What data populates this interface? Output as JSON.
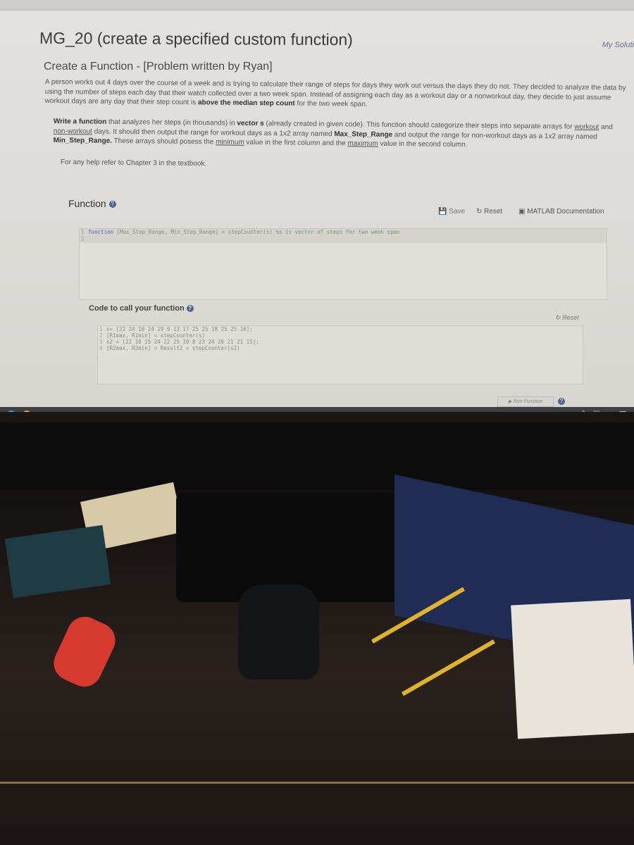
{
  "page": {
    "title": "MG_20 (create a specified custom function)",
    "my_solutions_link": "My Soluti"
  },
  "problem": {
    "heading": "Create a Function - [Problem written by Ryan]",
    "para1_a": "A person works out 4 days over the course of a week and is trying to calculate their range of steps for days they work out versus the days they do not. They decided to analyze the data by using the number of steps each day that their watch collected over a two week span. Instead of assigning each day as a workout day or a nonworkout day, they decide to just assume workout days are any day that their step count is ",
    "para1_bold": "above the median step count",
    "para1_b": " for the two week span.",
    "para2_bold1": "Write a function",
    "para2_a": " that analyzes her steps (in thousands) in ",
    "para2_bold2": "vector s",
    "para2_b": " (already created in given code). This function should categorize their steps into separate arrays for ",
    "para2_u1": "workout",
    "para2_c": " and ",
    "para2_u2": "non-workout",
    "para2_d": " days. It should then output the range for workout days as a 1x2 array named ",
    "para2_bold3": "Max_Step_Range",
    "para2_e": " and output the range for non-workout days as a 1x2 array named ",
    "para2_bold4": "Min_Step_Range.",
    "para2_f": " These arrays should posess the ",
    "para2_u3": "minimum",
    "para2_g": " value in the first column and the ",
    "para2_u4": "maximum",
    "para2_h": " value in the second column.",
    "para3": "For any help refer to Chapter 3 in the textbook."
  },
  "function_section": {
    "label": "Function",
    "save": "Save",
    "reset": "Reset",
    "docs": "MATLAB Documentation",
    "code": [
      {
        "n": "1",
        "kw": "function",
        "text": " [Max_Step_Range, Min_Step_Range] = stepCounter(s) ",
        "comment": "%s is vector of steps for two week span"
      },
      {
        "n": "2",
        "kw": "",
        "text": "",
        "comment": ""
      }
    ]
  },
  "call_section": {
    "label": "Code to call your function",
    "reset": "Reset",
    "code": [
      {
        "n": "1",
        "text": "s= [22 24 10 24 19 9 13 17 25 25 18 25 25 16];"
      },
      {
        "n": "2",
        "text": "[R1max, R1min] = stepCounter(s)"
      },
      {
        "n": "3",
        "text": "s2 = [22 10 15 24 22 25 19 8 23 24 20 21 21 15];"
      },
      {
        "n": "4",
        "text": "[R2max, R2min] = Result2 = stepCounter(s2)"
      }
    ],
    "run": "Run Function"
  },
  "colors": {
    "help_icon": "#4a6688",
    "keyword": "#4b5fbb",
    "taskbar": "#3d3f44"
  }
}
